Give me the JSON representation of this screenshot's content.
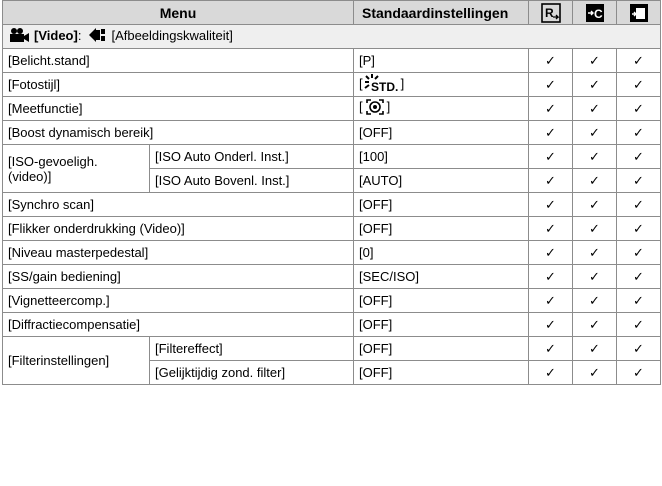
{
  "header": {
    "menu": "Menu",
    "standard": "Standaardinstellingen",
    "icon1": "reset-icon",
    "icon2": "copy-settings-icon",
    "icon3": "custom-mode-icon"
  },
  "section": {
    "video_label": "[Video]",
    "sep": ":",
    "quality_label": "[Afbeeldingskwaliteit]"
  },
  "check": "✓",
  "rows": {
    "r1": {
      "name": "[Belicht.stand]",
      "value": "[P]"
    },
    "r2": {
      "name": "[Fotostijl]",
      "value_open": "[",
      "value_icon": "standard-photostyle-icon",
      "value_close": "]",
      "icon_text": "STD."
    },
    "r3": {
      "name": "[Meetfunctie]",
      "value_open": "[",
      "value_icon": "multi-metering-icon",
      "value_close": "]"
    },
    "r4": {
      "name": "[Boost dynamisch bereik]",
      "value": "[OFF]"
    },
    "r5": {
      "group": "[ISO-gevoeligh. (video)]",
      "name": "[ISO Auto Onderl. Inst.]",
      "value": "[100]"
    },
    "r6": {
      "name": "[ISO Auto Bovenl. Inst.]",
      "value": "[AUTO]"
    },
    "r7": {
      "name": "[Synchro scan]",
      "value": "[OFF]"
    },
    "r8": {
      "name": "[Flikker onderdrukking (Video)]",
      "value": "[OFF]"
    },
    "r9": {
      "name": "[Niveau masterpedestal]",
      "value": "[0]"
    },
    "r10": {
      "name": "[SS/gain bediening]",
      "value": "[SEC/ISO]"
    },
    "r11": {
      "name": "[Vignetteercomp.]",
      "value": "[OFF]"
    },
    "r12": {
      "name": "[Diffractiecompensatie]",
      "value": "[OFF]"
    },
    "r13": {
      "group": "[Filterinstellingen]",
      "name": "[Filtereffect]",
      "value": "[OFF]"
    },
    "r14": {
      "name": "[Gelijktijdig zond. filter]",
      "value": "[OFF]"
    }
  }
}
